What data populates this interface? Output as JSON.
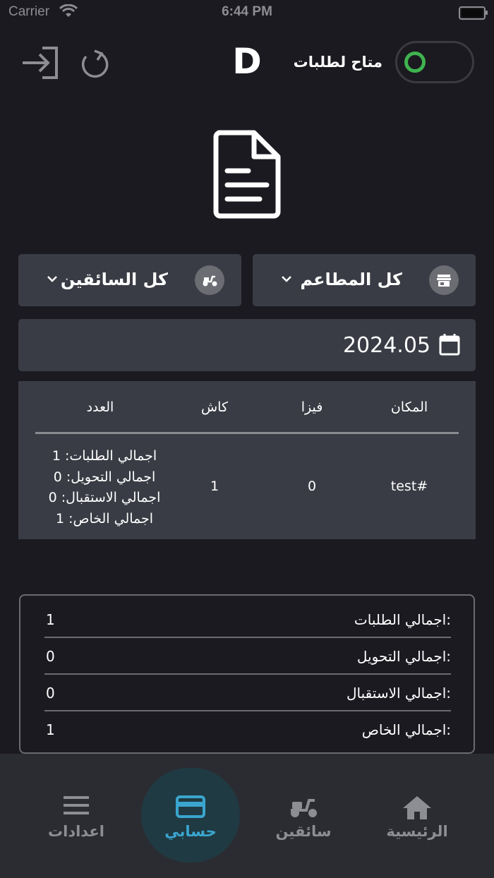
{
  "status_bar": {
    "carrier": "Carrier",
    "time": "6:44 PM"
  },
  "header": {
    "logo_letter": "D",
    "availability_label": "متاح لطلبات",
    "availability_on": true,
    "icons": [
      "logout-icon",
      "refresh-icon"
    ]
  },
  "filters": {
    "restaurants": {
      "label": "كل المطاعم",
      "icon": "store-icon"
    },
    "drivers": {
      "label": "كل السائقين",
      "icon": "scooter-icon"
    }
  },
  "date": {
    "value": "2024.05",
    "icon": "calendar-icon"
  },
  "table": {
    "headers": {
      "place": "المكان",
      "visa": "فيزا",
      "cash": "كاش",
      "count": "العدد"
    },
    "rows": [
      {
        "place": "test#",
        "visa": "0",
        "cash": "1",
        "count": [
          "اجمالي الطلبات: 1",
          "اجمالي التحويل: 0",
          "اجمالي الاستقبال: 0",
          "اجمالي الخاص: 1"
        ]
      }
    ]
  },
  "summary": [
    {
      "label": "اجمالي الطلبات:",
      "value": "1"
    },
    {
      "label": "اجمالي التحويل:",
      "value": "0"
    },
    {
      "label": "اجمالي الاستقبال:",
      "value": "0"
    },
    {
      "label": "اجمالي الخاص:",
      "value": "1"
    }
  ],
  "tabs": [
    {
      "label": "الرئيسية",
      "icon": "home-icon",
      "active": false
    },
    {
      "label": "سائقين",
      "icon": "scooter-icon",
      "active": false
    },
    {
      "label": "حسابي",
      "icon": "card-icon",
      "active": true
    },
    {
      "label": "اعدادات",
      "icon": "menu-icon",
      "active": false
    }
  ],
  "colors": {
    "background": "#1b1a20",
    "panel": "#3a3c45",
    "toggle_on": "#3fb34f",
    "accent": "#3aa6cf"
  }
}
